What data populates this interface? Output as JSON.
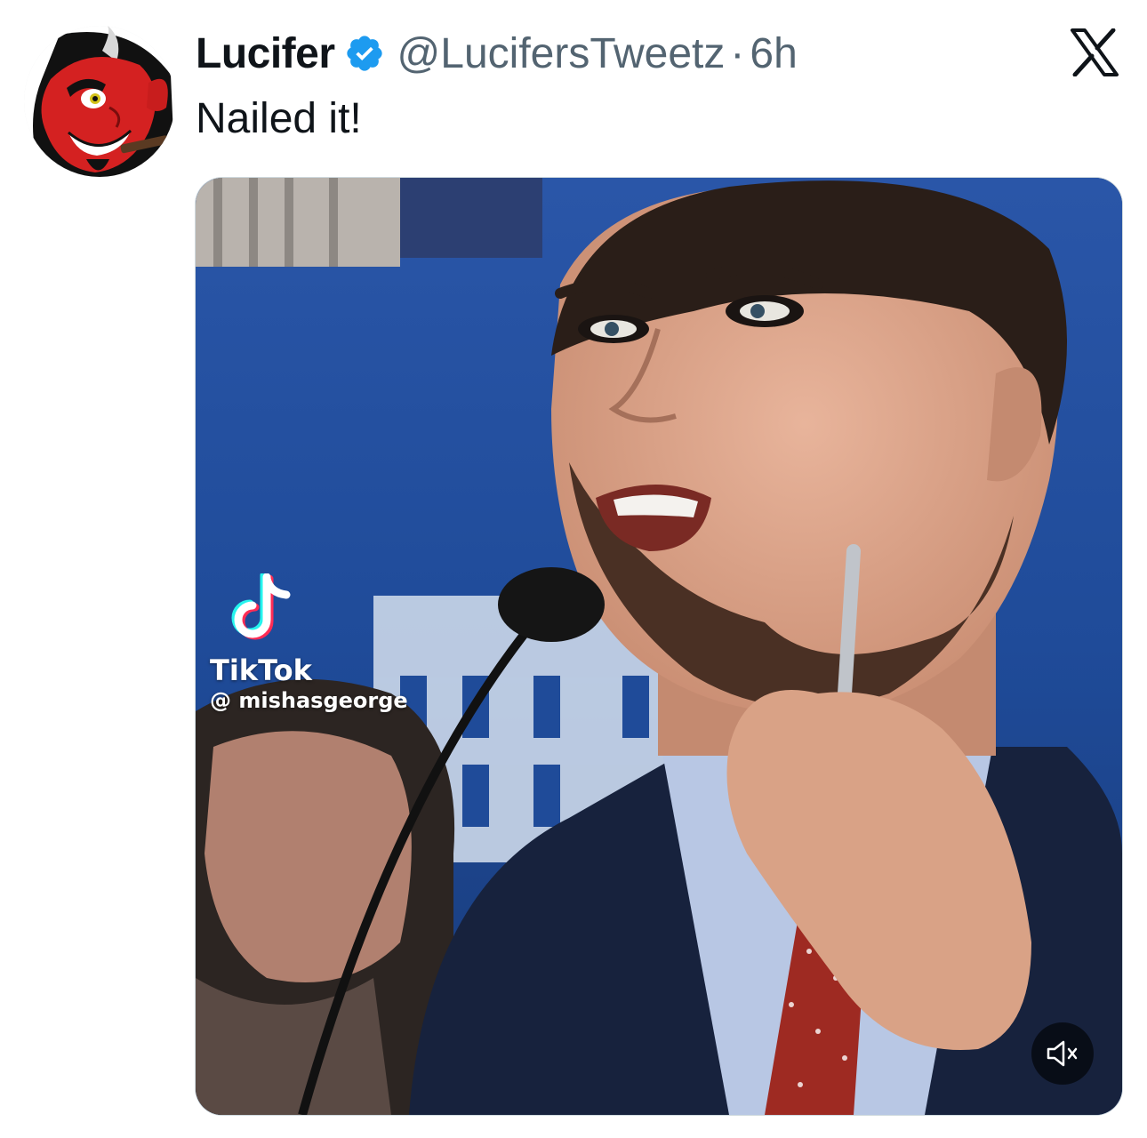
{
  "tweet": {
    "author": {
      "display_name": "Lucifer",
      "handle": "@LucifersTweetz",
      "verified": true,
      "avatar": "devil-cartoon-avatar"
    },
    "separator": "·",
    "time": "6h",
    "text": "Nailed it!",
    "media": {
      "type": "video",
      "watermark": {
        "brand": "TikTok",
        "user": "@ mishasgeorge"
      },
      "muted": true,
      "mute_icon": "speaker-muted-icon"
    }
  },
  "platform": {
    "logo": "x-logo-icon"
  },
  "colors": {
    "text_primary": "#0f1419",
    "text_secondary": "#536471",
    "verified_blue": "#1d9bf0",
    "media_background": "#1f3f7a"
  }
}
